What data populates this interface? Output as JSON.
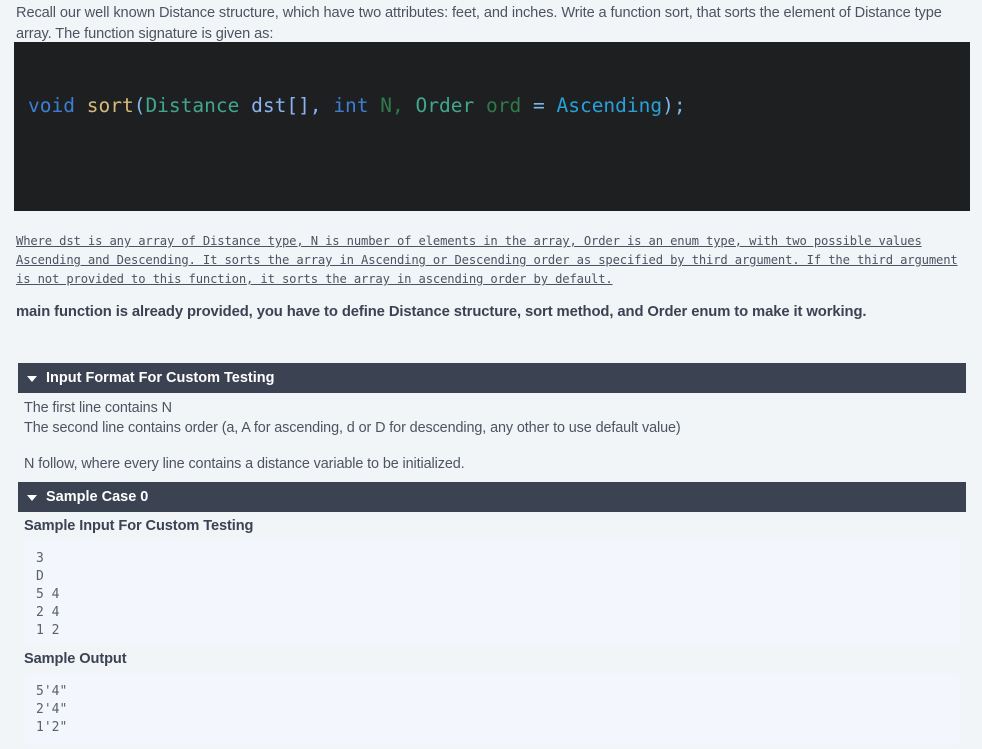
{
  "intro": {
    "paragraph": "Recall our well known Distance structure, which have two attributes: feet, and inches. Write a function sort, that sorts the element of Distance type array. The function signature is given as:"
  },
  "code": {
    "language": "cpp",
    "full_text": "void sort(Distance dst[], int N, Order ord = Ascending);",
    "tokens": {
      "kw_void": "void",
      "fn_sort": "sort",
      "paren_open": "(",
      "type_distance": "Distance",
      "var_dst": "dst[],",
      "kw_int": "int",
      "param_n": "N,",
      "type_order": "Order",
      "param_ord": "ord",
      "equals": "=",
      "enum_ascending": "Ascending",
      "paren_close": ");"
    },
    "background": "#1e1f21"
  },
  "mono_note": {
    "text": "Where dst is any array of Distance type, N is number of elements in the array, Order is an enum type, with two possible values Ascending and Descending. It sorts the array in Ascending or Descending order as specified by third argument. If the third argument is not provided to this function, it sorts the array in ascending order by default."
  },
  "bold_note": {
    "text": "main function is already provided, you have to define Distance structure, sort method, and Order enum to make it working."
  },
  "sections": {
    "input_format": {
      "header_label": "Input Format For Custom Testing",
      "caret_icon": "triangle-down-icon",
      "lines": [
        "The first line contains N",
        "The second line contains order (a, A for ascending, d or D for descending, any other to use default value)",
        "N follow, where every line contains a distance variable to be initialized."
      ]
    },
    "sample_case": {
      "header_label": "Sample Case 0",
      "caret_icon": "triangle-down-icon",
      "sample_input": {
        "title": "Sample Input For Custom Testing",
        "content": "3\nD\n5 4\n2 4\n1 2"
      },
      "sample_output": {
        "title": "Sample Output",
        "content": "5'4\"\n2'4\"\n1'2\""
      }
    }
  },
  "colors": {
    "page_background": "#f1f5f7",
    "header_bar": "#3b4252",
    "code_background": "#1e1f21",
    "sample_box_background": "#f4f6fd",
    "body_text": "#4d5362"
  }
}
